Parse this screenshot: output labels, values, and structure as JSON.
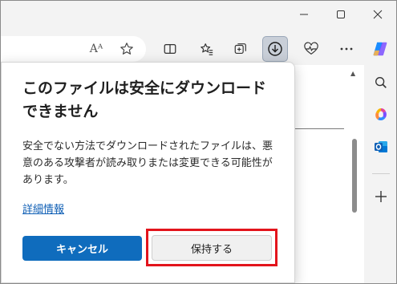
{
  "toolbar": {
    "read_aloud_label": "Aᴬ"
  },
  "popup": {
    "title": "このファイルは安全にダウンロードできません",
    "body": "安全でない方法でダウンロードされたファイルは、悪意のある攻撃者が読み取りまたは変更できる可能性があります。",
    "details_link": "詳細情報",
    "cancel_button": "キャンセル",
    "keep_button": "保持する",
    "highlight_color": "#e3141c"
  },
  "colors": {
    "primary_button": "#0f6cbd",
    "link": "#0f5fb5"
  },
  "icons": {
    "window": [
      "minimize-icon",
      "maximize-icon",
      "close-icon"
    ],
    "toolbar": [
      "read-aloud-icon",
      "favorite-star-icon",
      "split-screen-icon",
      "favorites-icon",
      "collections-icon",
      "downloads-icon",
      "browser-essentials-icon",
      "more-icon",
      "copilot-icon"
    ],
    "sidebar": [
      "search-icon",
      "copilot-icon",
      "outlook-icon",
      "add-icon"
    ]
  }
}
